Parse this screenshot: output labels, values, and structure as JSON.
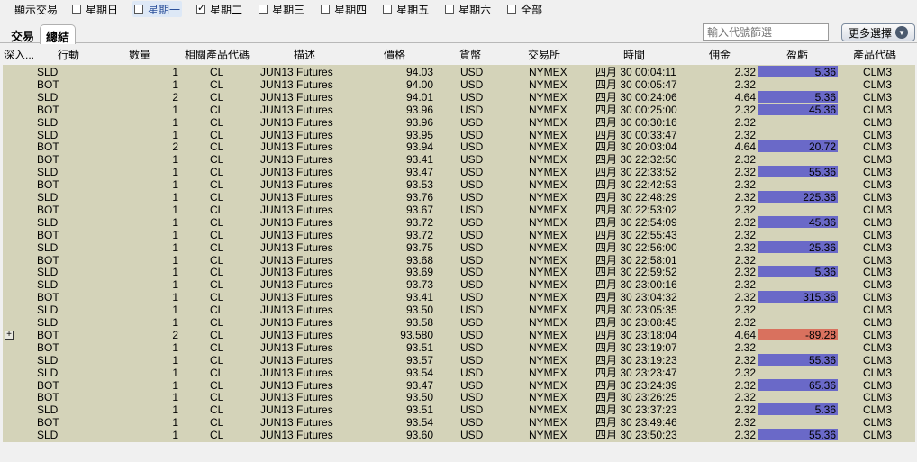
{
  "toolbar": {
    "show_trades_label": "顯示交易",
    "days": [
      {
        "label": "星期日",
        "checked": false,
        "highlight": false
      },
      {
        "label": "星期一",
        "checked": false,
        "highlight": true
      },
      {
        "label": "星期二",
        "checked": true,
        "highlight": false
      },
      {
        "label": "星期三",
        "checked": false,
        "highlight": false
      },
      {
        "label": "星期四",
        "checked": false,
        "highlight": false
      },
      {
        "label": "星期五",
        "checked": false,
        "highlight": false
      },
      {
        "label": "星期六",
        "checked": false,
        "highlight": false
      },
      {
        "label": "全部",
        "checked": false,
        "highlight": false
      }
    ]
  },
  "tabs": [
    {
      "label": "交易",
      "active": false
    },
    {
      "label": "總結",
      "active": true
    }
  ],
  "filter": {
    "placeholder": "輸入代號篩選"
  },
  "more_button": {
    "label": "更多選擇"
  },
  "columns": {
    "drill": "深入...",
    "action": "行動",
    "quantity": "數量",
    "symbol": "相關產品代碼",
    "description": "描述",
    "price": "價格",
    "currency": "貨幣",
    "exchange": "交易所",
    "time": "時間",
    "commission": "佣金",
    "pnl": "盈虧",
    "code": "產品代碼"
  },
  "colors": {
    "positive_pnl": "#6a69c8",
    "negative_pnl": "#d9715e",
    "grid_bg": "#d4d3b9"
  },
  "trades": [
    {
      "action": "SLD",
      "qty": "1",
      "symbol": "CL",
      "desc": "JUN13 Futures",
      "price": "94.03",
      "cur": "USD",
      "exch": "NYMEX",
      "time": "四月 30 00:04:11",
      "comm": "2.32",
      "pnl": "5.36",
      "code": "CLM3"
    },
    {
      "action": "BOT",
      "qty": "1",
      "symbol": "CL",
      "desc": "JUN13 Futures",
      "price": "94.00",
      "cur": "USD",
      "exch": "NYMEX",
      "time": "四月 30 00:05:47",
      "comm": "2.32",
      "pnl": "",
      "code": "CLM3"
    },
    {
      "action": "SLD",
      "qty": "2",
      "symbol": "CL",
      "desc": "JUN13 Futures",
      "price": "94.01",
      "cur": "USD",
      "exch": "NYMEX",
      "time": "四月 30 00:24:06",
      "comm": "4.64",
      "pnl": "5.36",
      "code": "CLM3"
    },
    {
      "action": "BOT",
      "qty": "1",
      "symbol": "CL",
      "desc": "JUN13 Futures",
      "price": "93.96",
      "cur": "USD",
      "exch": "NYMEX",
      "time": "四月 30 00:25:00",
      "comm": "2.32",
      "pnl": "45.36",
      "code": "CLM3"
    },
    {
      "action": "SLD",
      "qty": "1",
      "symbol": "CL",
      "desc": "JUN13 Futures",
      "price": "93.96",
      "cur": "USD",
      "exch": "NYMEX",
      "time": "四月 30 00:30:16",
      "comm": "2.32",
      "pnl": "",
      "code": "CLM3"
    },
    {
      "action": "SLD",
      "qty": "1",
      "symbol": "CL",
      "desc": "JUN13 Futures",
      "price": "93.95",
      "cur": "USD",
      "exch": "NYMEX",
      "time": "四月 30 00:33:47",
      "comm": "2.32",
      "pnl": "",
      "code": "CLM3"
    },
    {
      "action": "BOT",
      "qty": "2",
      "symbol": "CL",
      "desc": "JUN13 Futures",
      "price": "93.94",
      "cur": "USD",
      "exch": "NYMEX",
      "time": "四月 30 20:03:04",
      "comm": "4.64",
      "pnl": "20.72",
      "code": "CLM3"
    },
    {
      "action": "BOT",
      "qty": "1",
      "symbol": "CL",
      "desc": "JUN13 Futures",
      "price": "93.41",
      "cur": "USD",
      "exch": "NYMEX",
      "time": "四月 30 22:32:50",
      "comm": "2.32",
      "pnl": "",
      "code": "CLM3"
    },
    {
      "action": "SLD",
      "qty": "1",
      "symbol": "CL",
      "desc": "JUN13 Futures",
      "price": "93.47",
      "cur": "USD",
      "exch": "NYMEX",
      "time": "四月 30 22:33:52",
      "comm": "2.32",
      "pnl": "55.36",
      "code": "CLM3"
    },
    {
      "action": "BOT",
      "qty": "1",
      "symbol": "CL",
      "desc": "JUN13 Futures",
      "price": "93.53",
      "cur": "USD",
      "exch": "NYMEX",
      "time": "四月 30 22:42:53",
      "comm": "2.32",
      "pnl": "",
      "code": "CLM3"
    },
    {
      "action": "SLD",
      "qty": "1",
      "symbol": "CL",
      "desc": "JUN13 Futures",
      "price": "93.76",
      "cur": "USD",
      "exch": "NYMEX",
      "time": "四月 30 22:48:29",
      "comm": "2.32",
      "pnl": "225.36",
      "code": "CLM3"
    },
    {
      "action": "BOT",
      "qty": "1",
      "symbol": "CL",
      "desc": "JUN13 Futures",
      "price": "93.67",
      "cur": "USD",
      "exch": "NYMEX",
      "time": "四月 30 22:53:02",
      "comm": "2.32",
      "pnl": "",
      "code": "CLM3"
    },
    {
      "action": "SLD",
      "qty": "1",
      "symbol": "CL",
      "desc": "JUN13 Futures",
      "price": "93.72",
      "cur": "USD",
      "exch": "NYMEX",
      "time": "四月 30 22:54:09",
      "comm": "2.32",
      "pnl": "45.36",
      "code": "CLM3"
    },
    {
      "action": "BOT",
      "qty": "1",
      "symbol": "CL",
      "desc": "JUN13 Futures",
      "price": "93.72",
      "cur": "USD",
      "exch": "NYMEX",
      "time": "四月 30 22:55:43",
      "comm": "2.32",
      "pnl": "",
      "code": "CLM3"
    },
    {
      "action": "SLD",
      "qty": "1",
      "symbol": "CL",
      "desc": "JUN13 Futures",
      "price": "93.75",
      "cur": "USD",
      "exch": "NYMEX",
      "time": "四月 30 22:56:00",
      "comm": "2.32",
      "pnl": "25.36",
      "code": "CLM3"
    },
    {
      "action": "BOT",
      "qty": "1",
      "symbol": "CL",
      "desc": "JUN13 Futures",
      "price": "93.68",
      "cur": "USD",
      "exch": "NYMEX",
      "time": "四月 30 22:58:01",
      "comm": "2.32",
      "pnl": "",
      "code": "CLM3"
    },
    {
      "action": "SLD",
      "qty": "1",
      "symbol": "CL",
      "desc": "JUN13 Futures",
      "price": "93.69",
      "cur": "USD",
      "exch": "NYMEX",
      "time": "四月 30 22:59:52",
      "comm": "2.32",
      "pnl": "5.36",
      "code": "CLM3"
    },
    {
      "action": "SLD",
      "qty": "1",
      "symbol": "CL",
      "desc": "JUN13 Futures",
      "price": "93.73",
      "cur": "USD",
      "exch": "NYMEX",
      "time": "四月 30 23:00:16",
      "comm": "2.32",
      "pnl": "",
      "code": "CLM3"
    },
    {
      "action": "BOT",
      "qty": "1",
      "symbol": "CL",
      "desc": "JUN13 Futures",
      "price": "93.41",
      "cur": "USD",
      "exch": "NYMEX",
      "time": "四月 30 23:04:32",
      "comm": "2.32",
      "pnl": "315.36",
      "code": "CLM3"
    },
    {
      "action": "SLD",
      "qty": "1",
      "symbol": "CL",
      "desc": "JUN13 Futures",
      "price": "93.50",
      "cur": "USD",
      "exch": "NYMEX",
      "time": "四月 30 23:05:35",
      "comm": "2.32",
      "pnl": "",
      "code": "CLM3"
    },
    {
      "action": "SLD",
      "qty": "1",
      "symbol": "CL",
      "desc": "JUN13 Futures",
      "price": "93.58",
      "cur": "USD",
      "exch": "NYMEX",
      "time": "四月 30 23:08:45",
      "comm": "2.32",
      "pnl": "",
      "code": "CLM3"
    },
    {
      "action": "BOT",
      "qty": "2",
      "symbol": "CL",
      "desc": "JUN13 Futures",
      "price": "93.580",
      "cur": "USD",
      "exch": "NYMEX",
      "time": "四月 30 23:18:04",
      "comm": "4.64",
      "pnl": "-89.28",
      "code": "CLM3",
      "expandable": true
    },
    {
      "action": "BOT",
      "qty": "1",
      "symbol": "CL",
      "desc": "JUN13 Futures",
      "price": "93.51",
      "cur": "USD",
      "exch": "NYMEX",
      "time": "四月 30 23:19:07",
      "comm": "2.32",
      "pnl": "",
      "code": "CLM3"
    },
    {
      "action": "SLD",
      "qty": "1",
      "symbol": "CL",
      "desc": "JUN13 Futures",
      "price": "93.57",
      "cur": "USD",
      "exch": "NYMEX",
      "time": "四月 30 23:19:23",
      "comm": "2.32",
      "pnl": "55.36",
      "code": "CLM3"
    },
    {
      "action": "SLD",
      "qty": "1",
      "symbol": "CL",
      "desc": "JUN13 Futures",
      "price": "93.54",
      "cur": "USD",
      "exch": "NYMEX",
      "time": "四月 30 23:23:47",
      "comm": "2.32",
      "pnl": "",
      "code": "CLM3"
    },
    {
      "action": "BOT",
      "qty": "1",
      "symbol": "CL",
      "desc": "JUN13 Futures",
      "price": "93.47",
      "cur": "USD",
      "exch": "NYMEX",
      "time": "四月 30 23:24:39",
      "comm": "2.32",
      "pnl": "65.36",
      "code": "CLM3"
    },
    {
      "action": "BOT",
      "qty": "1",
      "symbol": "CL",
      "desc": "JUN13 Futures",
      "price": "93.50",
      "cur": "USD",
      "exch": "NYMEX",
      "time": "四月 30 23:26:25",
      "comm": "2.32",
      "pnl": "",
      "code": "CLM3"
    },
    {
      "action": "SLD",
      "qty": "1",
      "symbol": "CL",
      "desc": "JUN13 Futures",
      "price": "93.51",
      "cur": "USD",
      "exch": "NYMEX",
      "time": "四月 30 23:37:23",
      "comm": "2.32",
      "pnl": "5.36",
      "code": "CLM3"
    },
    {
      "action": "BOT",
      "qty": "1",
      "symbol": "CL",
      "desc": "JUN13 Futures",
      "price": "93.54",
      "cur": "USD",
      "exch": "NYMEX",
      "time": "四月 30 23:49:46",
      "comm": "2.32",
      "pnl": "",
      "code": "CLM3"
    },
    {
      "action": "SLD",
      "qty": "1",
      "symbol": "CL",
      "desc": "JUN13 Futures",
      "price": "93.60",
      "cur": "USD",
      "exch": "NYMEX",
      "time": "四月 30 23:50:23",
      "comm": "2.32",
      "pnl": "55.36",
      "code": "CLM3"
    }
  ]
}
